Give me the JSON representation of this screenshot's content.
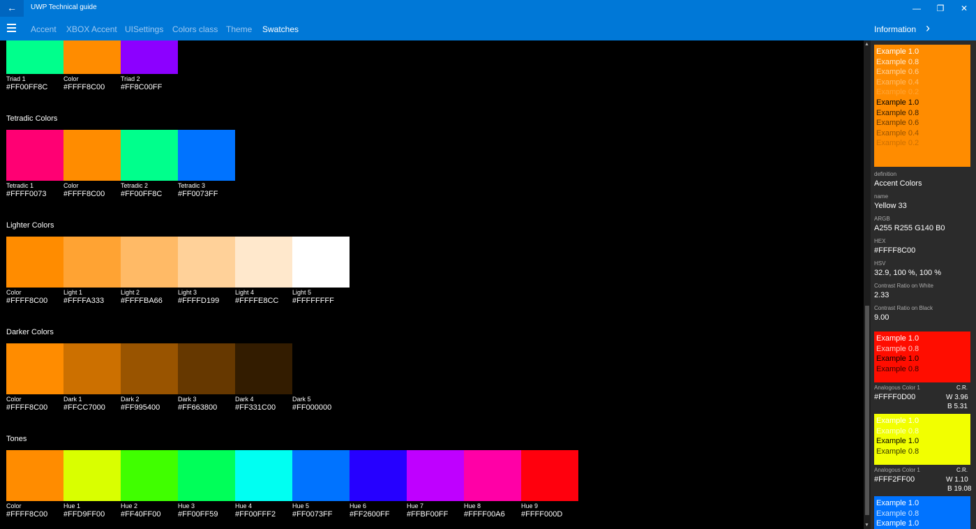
{
  "app": {
    "title": "UWP Technical guide"
  },
  "window_controls": {
    "minimize": "—",
    "restore": "❐",
    "close": "✕"
  },
  "nav": {
    "items": [
      {
        "label": "Accent",
        "active": false
      },
      {
        "label": "XBOX Accent",
        "active": false
      },
      {
        "label": "UISettings",
        "active": false
      },
      {
        "label": "Colors class",
        "active": false
      },
      {
        "label": "Theme",
        "active": false
      },
      {
        "label": "Swatches",
        "active": true
      }
    ],
    "info_label": "Information"
  },
  "sections": [
    {
      "title": "",
      "swatches": [
        {
          "label": "Triad 1",
          "hex": "#FF00FF8C",
          "color": "#00FF8C"
        },
        {
          "label": "Color",
          "hex": "#FFFF8C00",
          "color": "#FF8C00"
        },
        {
          "label": "Triad 2",
          "hex": "#FF8C00FF",
          "color": "#8C00FF"
        }
      ]
    },
    {
      "title": "Tetradic Colors",
      "swatches": [
        {
          "label": "Tetradic 1",
          "hex": "#FFFF0073",
          "color": "#FF0073"
        },
        {
          "label": "Color",
          "hex": "#FFFF8C00",
          "color": "#FF8C00"
        },
        {
          "label": "Tetradic 2",
          "hex": "#FF00FF8C",
          "color": "#00FF8C"
        },
        {
          "label": "Tetradic 3",
          "hex": "#FF0073FF",
          "color": "#0073FF"
        }
      ]
    },
    {
      "title": "Lighter Colors",
      "swatches": [
        {
          "label": "Color",
          "hex": "#FFFF8C00",
          "color": "#FF8C00"
        },
        {
          "label": "Light 1",
          "hex": "#FFFFA333",
          "color": "#FFA333"
        },
        {
          "label": "Light 2",
          "hex": "#FFFFBA66",
          "color": "#FFBA66"
        },
        {
          "label": "Light 3",
          "hex": "#FFFFD199",
          "color": "#FFD199"
        },
        {
          "label": "Light 4",
          "hex": "#FFFFE8CC",
          "color": "#FFE8CC"
        },
        {
          "label": "Light 5",
          "hex": "#FFFFFFFF",
          "color": "#FFFFFF"
        }
      ]
    },
    {
      "title": "Darker Colors",
      "swatches": [
        {
          "label": "Color",
          "hex": "#FFFF8C00",
          "color": "#FF8C00"
        },
        {
          "label": "Dark 1",
          "hex": "#FFCC7000",
          "color": "#CC7000"
        },
        {
          "label": "Dark 2",
          "hex": "#FF995400",
          "color": "#995400"
        },
        {
          "label": "Dark 3",
          "hex": "#FF663800",
          "color": "#663800"
        },
        {
          "label": "Dark 4",
          "hex": "#FF331C00",
          "color": "#331C00"
        },
        {
          "label": "Dark 5",
          "hex": "#FF000000",
          "color": "#000000"
        }
      ]
    },
    {
      "title": "Tones",
      "swatches": [
        {
          "label": "Color",
          "hex": "#FFFF8C00",
          "color": "#FF8C00"
        },
        {
          "label": "Hue 1",
          "hex": "#FFD9FF00",
          "color": "#D9FF00"
        },
        {
          "label": "Hue 2",
          "hex": "#FF40FF00",
          "color": "#40FF00"
        },
        {
          "label": "Hue 3",
          "hex": "#FF00FF59",
          "color": "#00FF59"
        },
        {
          "label": "Hue 4",
          "hex": "#FF00FFF2",
          "color": "#00FFF2"
        },
        {
          "label": "Hue 5",
          "hex": "#FF0073FF",
          "color": "#0073FF"
        },
        {
          "label": "Hue 6",
          "hex": "#FF2600FF",
          "color": "#2600FF"
        },
        {
          "label": "Hue 7",
          "hex": "#FFBF00FF",
          "color": "#BF00FF"
        },
        {
          "label": "Hue 8",
          "hex": "#FFFF00A6",
          "color": "#FF00A6"
        },
        {
          "label": "Hue 9",
          "hex": "#FFFF000D",
          "color": "#FF000D"
        }
      ]
    }
  ],
  "info": {
    "main_examples": [
      {
        "text": "Example 1.0",
        "color": "#FFFFFF",
        "opacity": 1.0
      },
      {
        "text": "Example 0.8",
        "color": "#FFFFFF",
        "opacity": 0.8
      },
      {
        "text": "Example 0.6",
        "color": "#FFFFFF",
        "opacity": 0.6
      },
      {
        "text": "Example 0.4",
        "color": "#FFFFFF",
        "opacity": 0.4
      },
      {
        "text": "Example 0.2",
        "color": "#FFFFFF",
        "opacity": 0.2
      },
      {
        "text": "Example 1.0",
        "color": "#000000",
        "opacity": 1.0
      },
      {
        "text": "Example 0.8",
        "color": "#000000",
        "opacity": 0.8
      },
      {
        "text": "Example 0.6",
        "color": "#000000",
        "opacity": 0.6
      },
      {
        "text": "Example 0.4",
        "color": "#000000",
        "opacity": 0.4
      },
      {
        "text": "Example 0.2",
        "color": "#000000",
        "opacity": 0.2
      }
    ],
    "main_color": "#FF8C00",
    "props": [
      {
        "key": "definition",
        "value": "Accent Colors"
      },
      {
        "key": "name",
        "value": "Yellow 33"
      },
      {
        "key": "ARGB",
        "value": "A255 R255 G140 B0"
      },
      {
        "key": "HEX",
        "value": "#FFFF8C00"
      },
      {
        "key": "HSV",
        "value": "32.9, 100 %, 100 %"
      },
      {
        "key": "Contrast Ratio on White",
        "value": "2.33"
      },
      {
        "key": "Contrast Ratio on Black",
        "value": "9.00"
      }
    ],
    "analogous": [
      {
        "color": "#FF0D00",
        "examples": [
          {
            "text": "Example 1.0",
            "color": "#FFFFFF",
            "opacity": 1.0
          },
          {
            "text": "Example 0.8",
            "color": "#FFFFFF",
            "opacity": 0.8
          },
          {
            "text": "Example 1.0",
            "color": "#000000",
            "opacity": 1.0
          },
          {
            "text": "Example 0.8",
            "color": "#000000",
            "opacity": 0.8
          }
        ],
        "label": "Analogous Color 1",
        "cr": "C.R.",
        "hex": "#FFFF0D00",
        "w": "W 3.96",
        "b": "B 5.31"
      },
      {
        "color": "#F2FF00",
        "examples": [
          {
            "text": "Example 1.0",
            "color": "#FFFFFF",
            "opacity": 1.0
          },
          {
            "text": "Example 0.8",
            "color": "#FFFFFF",
            "opacity": 0.8
          },
          {
            "text": "Example 1.0",
            "color": "#000000",
            "opacity": 1.0
          },
          {
            "text": "Example 0.8",
            "color": "#000000",
            "opacity": 0.8
          }
        ],
        "label": "Analogous Color 1",
        "cr": "C.R.",
        "hex": "#FFF2FF00",
        "w": "W 1.10",
        "b": "B 19.08"
      },
      {
        "color": "#0073FF",
        "examples": [
          {
            "text": "Example 1.0",
            "color": "#FFFFFF",
            "opacity": 1.0
          },
          {
            "text": "Example 0.8",
            "color": "#FFFFFF",
            "opacity": 0.8
          },
          {
            "text": "Example 1.0",
            "color": "#FFFFFF",
            "opacity": 1.0
          }
        ]
      }
    ]
  }
}
